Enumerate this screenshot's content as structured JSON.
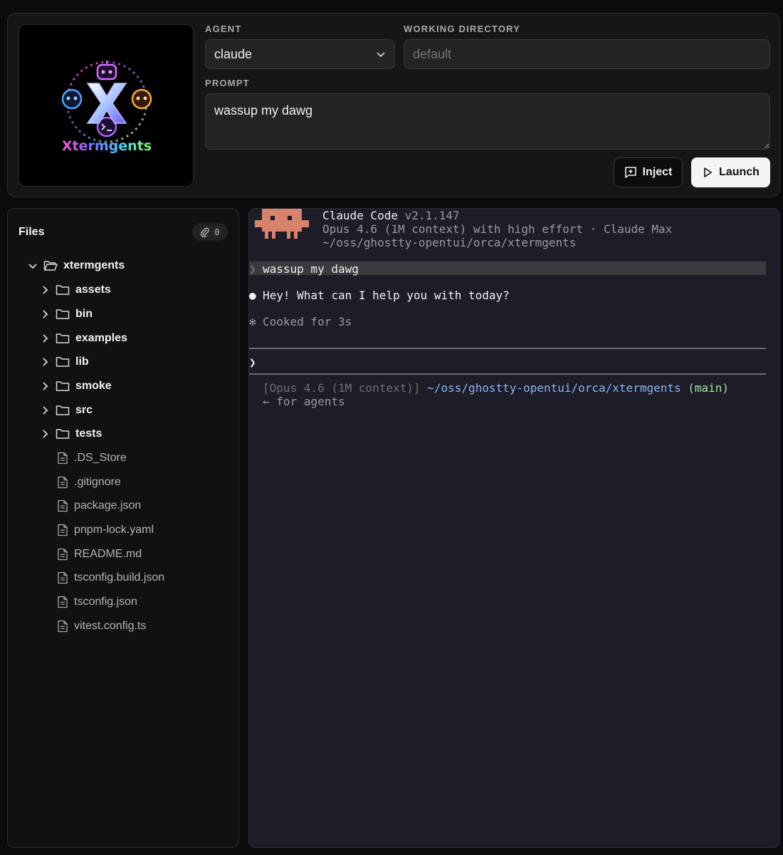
{
  "logo": {
    "text": "Xtermgents",
    "icon": "xtermgents-logo-icon"
  },
  "form": {
    "agent_label": "AGENT",
    "agent_value": "claude",
    "workdir_label": "WORKING DIRECTORY",
    "workdir_placeholder": "default",
    "prompt_label": "PROMPT",
    "prompt_value": "wassup my dawg",
    "inject_label": "Inject",
    "launch_label": "Launch"
  },
  "files": {
    "title": "Files",
    "attach_count": "0",
    "root": "xtermgents",
    "folders": [
      "assets",
      "bin",
      "examples",
      "lib",
      "smoke",
      "src",
      "tests"
    ],
    "items": [
      ".DS_Store",
      ".gitignore",
      "package.json",
      "pnpm-lock.yaml",
      "README.md",
      "tsconfig.build.json",
      "tsconfig.json",
      "vitest.config.ts"
    ]
  },
  "terminal": {
    "app_name": "Claude Code",
    "version": "v2.1.147",
    "model_line": "Opus 4.6 (1M context) with high effort · Claude Max",
    "cwd_line": "~/oss/ghostty-opentui/orca/xtermgents",
    "prompt_marker": "❯",
    "user_input": "wassup my dawg",
    "reply_bullet": "●",
    "reply": "Hey! What can I help you with today?",
    "cooked_marker": "✻",
    "cooked": "Cooked for 3s",
    "input_marker": "❯",
    "status_model": "[Opus 4.6 (1M context)]",
    "status_path": "~/oss/ghostty-opentui/orca/xtermgents",
    "status_branch": "(main)",
    "status_hint": "← for agents"
  },
  "colors": {
    "terminal_bg": "#1d1d28",
    "mascot": "#d7826a",
    "path_blue": "#8ab4f8",
    "branch_green": "#a6e3a1"
  }
}
